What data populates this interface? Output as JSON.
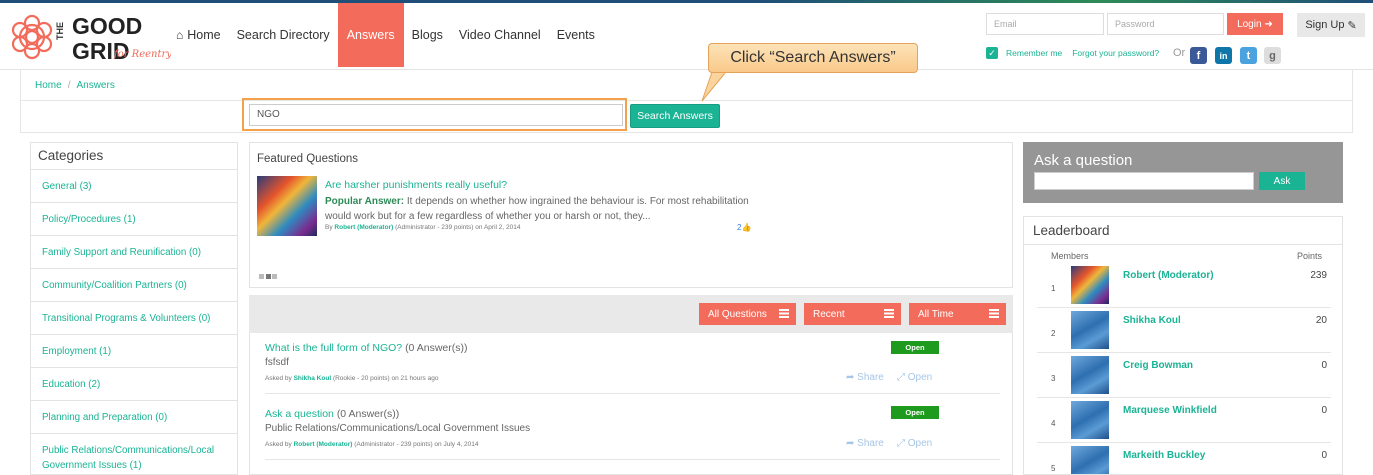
{
  "brand": {
    "logo_the": "THE",
    "logo_good": "GOOD",
    "logo_grid": "GRID",
    "logo_tag": "for Reentry",
    "accent": "#f26b5b",
    "green": "#1ab394"
  },
  "nav": {
    "home": "Home",
    "search_directory": "Search Directory",
    "answers": "Answers",
    "blogs": "Blogs",
    "video_channel": "Video Channel",
    "events": "Events"
  },
  "auth": {
    "email_placeholder": "Email",
    "password_placeholder": "Password",
    "login": "Login",
    "signup": "Sign Up",
    "remember": "Remember me",
    "forgot": "Forgot your password?",
    "or": "Or"
  },
  "social": {
    "facebook": "f",
    "linkedin": "in",
    "twitter": "t",
    "google": "g"
  },
  "breadcrumb": {
    "home": "Home",
    "current": "Answers"
  },
  "search": {
    "value": "NGO",
    "button": "Search Answers"
  },
  "callout": {
    "text": "Click “Search Answers”"
  },
  "categories": {
    "title": "Categories",
    "items": [
      "General (3)",
      "Policy/Procedures (1)",
      "Family Support and Reunification (0)",
      "Community/Coalition Partners (0)",
      "Transitional Programs & Volunteers (0)",
      "Employment (1)",
      "Education (2)",
      "Planning and Preparation (0)",
      "Public Relations/Communications/Local Government Issues (1)"
    ]
  },
  "featured": {
    "title": "Featured Questions",
    "question": "Are harsher punishments really useful?",
    "popular_label": "Popular Answer:",
    "answer": "It depends on whether how ingrained the behaviour is. For most rehabilitation would work but for a few regardless of whether you or harsh or not, they...",
    "by": "By",
    "author": "Robert (Moderator)",
    "author_meta": "(Administrator - 239 points)",
    "date": "on April 2, 2014",
    "likes": "2"
  },
  "filters": {
    "all_questions": "All Questions",
    "recent": "Recent",
    "all_time": "All Time"
  },
  "questions": [
    {
      "title": "What is the full form of NGO?",
      "count": "(0 Answer(s))",
      "desc": "fsfsdf",
      "asked_by": "Asked by",
      "author": "Shikha Koul",
      "meta": "(Rookie - 20 points)  on 21 hours ago",
      "status": "Open",
      "share": "Share",
      "open": "Open"
    },
    {
      "title": "Ask a question",
      "count": "(0 Answer(s))",
      "desc": "Public Relations/Communications/Local Government Issues",
      "asked_by": "Asked by",
      "author": "Robert (Moderator)",
      "meta": "(Administrator - 239 points)  on July 4, 2014",
      "status": "Open",
      "share": "Share",
      "open": "Open"
    }
  ],
  "ask": {
    "title": "Ask a question",
    "button": "Ask"
  },
  "leaderboard": {
    "title": "Leaderboard",
    "members_label": "Members",
    "points_label": "Points",
    "rows": [
      {
        "rank": "1",
        "name": "Robert (Moderator)",
        "points": "239"
      },
      {
        "rank": "2",
        "name": "Shikha Koul",
        "points": "20"
      },
      {
        "rank": "3",
        "name": "Creig Bowman",
        "points": "0"
      },
      {
        "rank": "4",
        "name": "Marquese Winkfield",
        "points": "0"
      },
      {
        "rank": "5",
        "name": "Markeith Buckley",
        "points": "0"
      }
    ]
  }
}
